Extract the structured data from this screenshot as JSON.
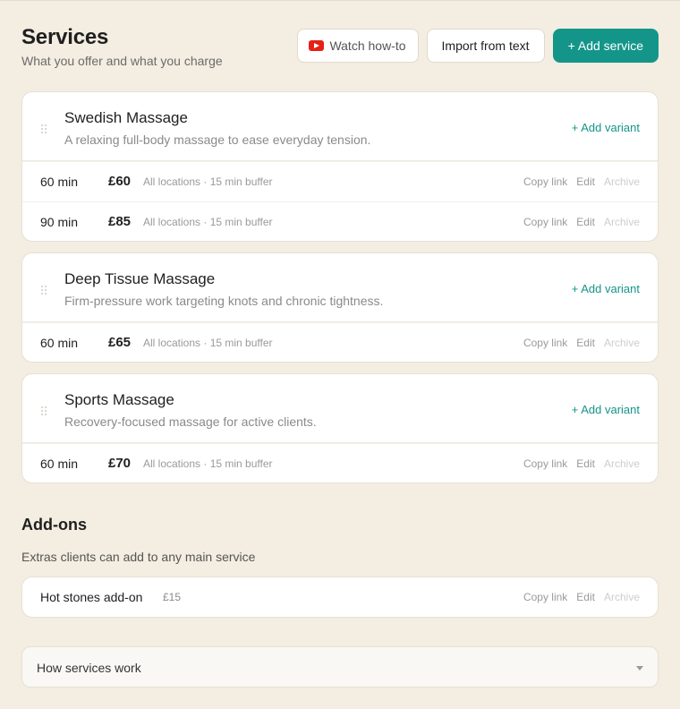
{
  "header": {
    "title": "Services",
    "subtitle": "What you offer and what you charge",
    "watch_label": "Watch how-to",
    "import_label": "Import from text",
    "add_service_label": "+ Add service"
  },
  "colors": {
    "accent": "#14958a",
    "background": "#f4ede1",
    "youtube": "#e62117"
  },
  "services": [
    {
      "name": "Swedish Massage",
      "description": "A relaxing full-body massage to ease everyday tension.",
      "add_variant": "+ Add variant",
      "variants": [
        {
          "duration": "60 min",
          "price": "£60",
          "meta": "All locations  · 15 min buffer"
        },
        {
          "duration": "90 min",
          "price": "£85",
          "meta": "All locations  · 15 min buffer"
        }
      ]
    },
    {
      "name": "Deep Tissue Massage",
      "description": "Firm-pressure work targeting knots and chronic tightness.",
      "add_variant": "+ Add variant",
      "variants": [
        {
          "duration": "60 min",
          "price": "£65",
          "meta": "All locations  · 15 min buffer"
        }
      ]
    },
    {
      "name": "Sports Massage",
      "description": "Recovery-focused massage for active clients.",
      "add_variant": "+ Add variant",
      "variants": [
        {
          "duration": "60 min",
          "price": "£70",
          "meta": "All locations  · 15 min buffer"
        }
      ]
    }
  ],
  "row_actions": {
    "copy": "Copy link",
    "edit": "Edit",
    "archive": "Archive"
  },
  "addons": {
    "title": "Add-ons",
    "subtitle": "Extras clients can add to any main service",
    "items": [
      {
        "name": "Hot stones add-on",
        "price": "£15"
      }
    ]
  },
  "how": {
    "label": "How services work",
    "icon": "chevron-down-icon"
  },
  "icons": {
    "watch": "youtube-icon",
    "grip": "drag-handle-icon"
  }
}
